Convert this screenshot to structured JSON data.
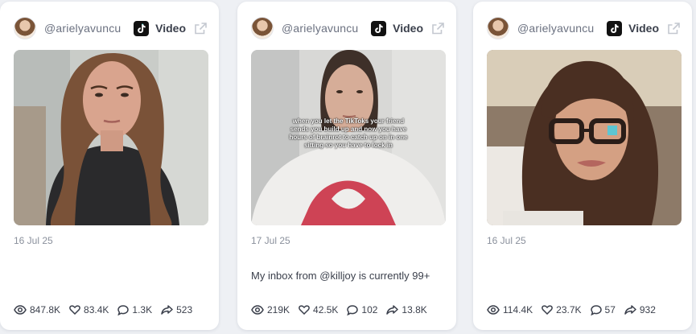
{
  "colors": {
    "page_background": "#eef0f4",
    "card_background": "#ffffff",
    "text_primary": "#3a3f4b",
    "text_muted": "#8a909c"
  },
  "icons": {
    "platform": "tiktok-icon",
    "open_link": "external-link-icon",
    "views": "eye-icon",
    "likes": "heart-icon",
    "comments": "comment-icon",
    "shares": "share-icon"
  },
  "cards": [
    {
      "handle": "@arielyavuncu",
      "platform_label": "Video",
      "date": "16 Jul 25",
      "caption": "",
      "overlay_text": "",
      "stats": {
        "views": "847.8K",
        "likes": "83.4K",
        "comments": "1.3K",
        "shares": "523"
      }
    },
    {
      "handle": "@arielyavuncu",
      "platform_label": "Video",
      "date": "17 Jul 25",
      "caption": "My inbox from @killjoy is currently 99+",
      "overlay_text": "when you let the TikToks your friend sends you build up and now you have hours of brainrot to catch up on in one sitting so you have to lock in",
      "stats": {
        "views": "219K",
        "likes": "42.5K",
        "comments": "102",
        "shares": "13.8K"
      }
    },
    {
      "handle": "@arielyavuncu",
      "platform_label": "Video",
      "date": "16 Jul 25",
      "caption": "",
      "overlay_text": "",
      "stats": {
        "views": "114.4K",
        "likes": "23.7K",
        "comments": "57",
        "shares": "932"
      }
    }
  ]
}
